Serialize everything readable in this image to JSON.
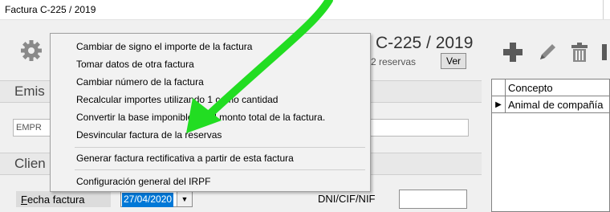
{
  "window": {
    "title": "Factura C-225 / 2019"
  },
  "header": {
    "title": "C-225 / 2019",
    "reservas_text": "a 2 reservas",
    "ver_button": "Ver"
  },
  "sections": {
    "emisor": "Emis",
    "cliente": "Clien"
  },
  "emisor": {
    "value": "EMPR"
  },
  "cliente": {
    "fecha_label_u": "F",
    "fecha_label_rest": "echa factura",
    "fecha_value": "27/04/2020",
    "dni_label": "DNI/CIF/NIF",
    "dni_value": ""
  },
  "grid": {
    "header": "Concepto",
    "rows": [
      {
        "concepto": "Animal de compañía"
      }
    ]
  },
  "context_menu": {
    "items": [
      "Cambiar de signo el importe de la factura",
      "Tomar datos de otra factura",
      "Cambiar número de la factura",
      "Recalcular importes utilizando 1 como cantidad",
      "Convertir la base imponible en el monto total de la factura.",
      "Desvincular factura de la reservas",
      "Generar factura rectificativa a partir de esta factura",
      "Configuración general del IRPF"
    ]
  },
  "icons": {
    "gear": "gear-icon",
    "toolbar": [
      "add-icon",
      "edit-icon",
      "delete-icon",
      "next-icon"
    ],
    "annotation": "green-arrow-annotation"
  },
  "colors": {
    "arrow": "#22dd22",
    "selection": "#0078d7"
  }
}
